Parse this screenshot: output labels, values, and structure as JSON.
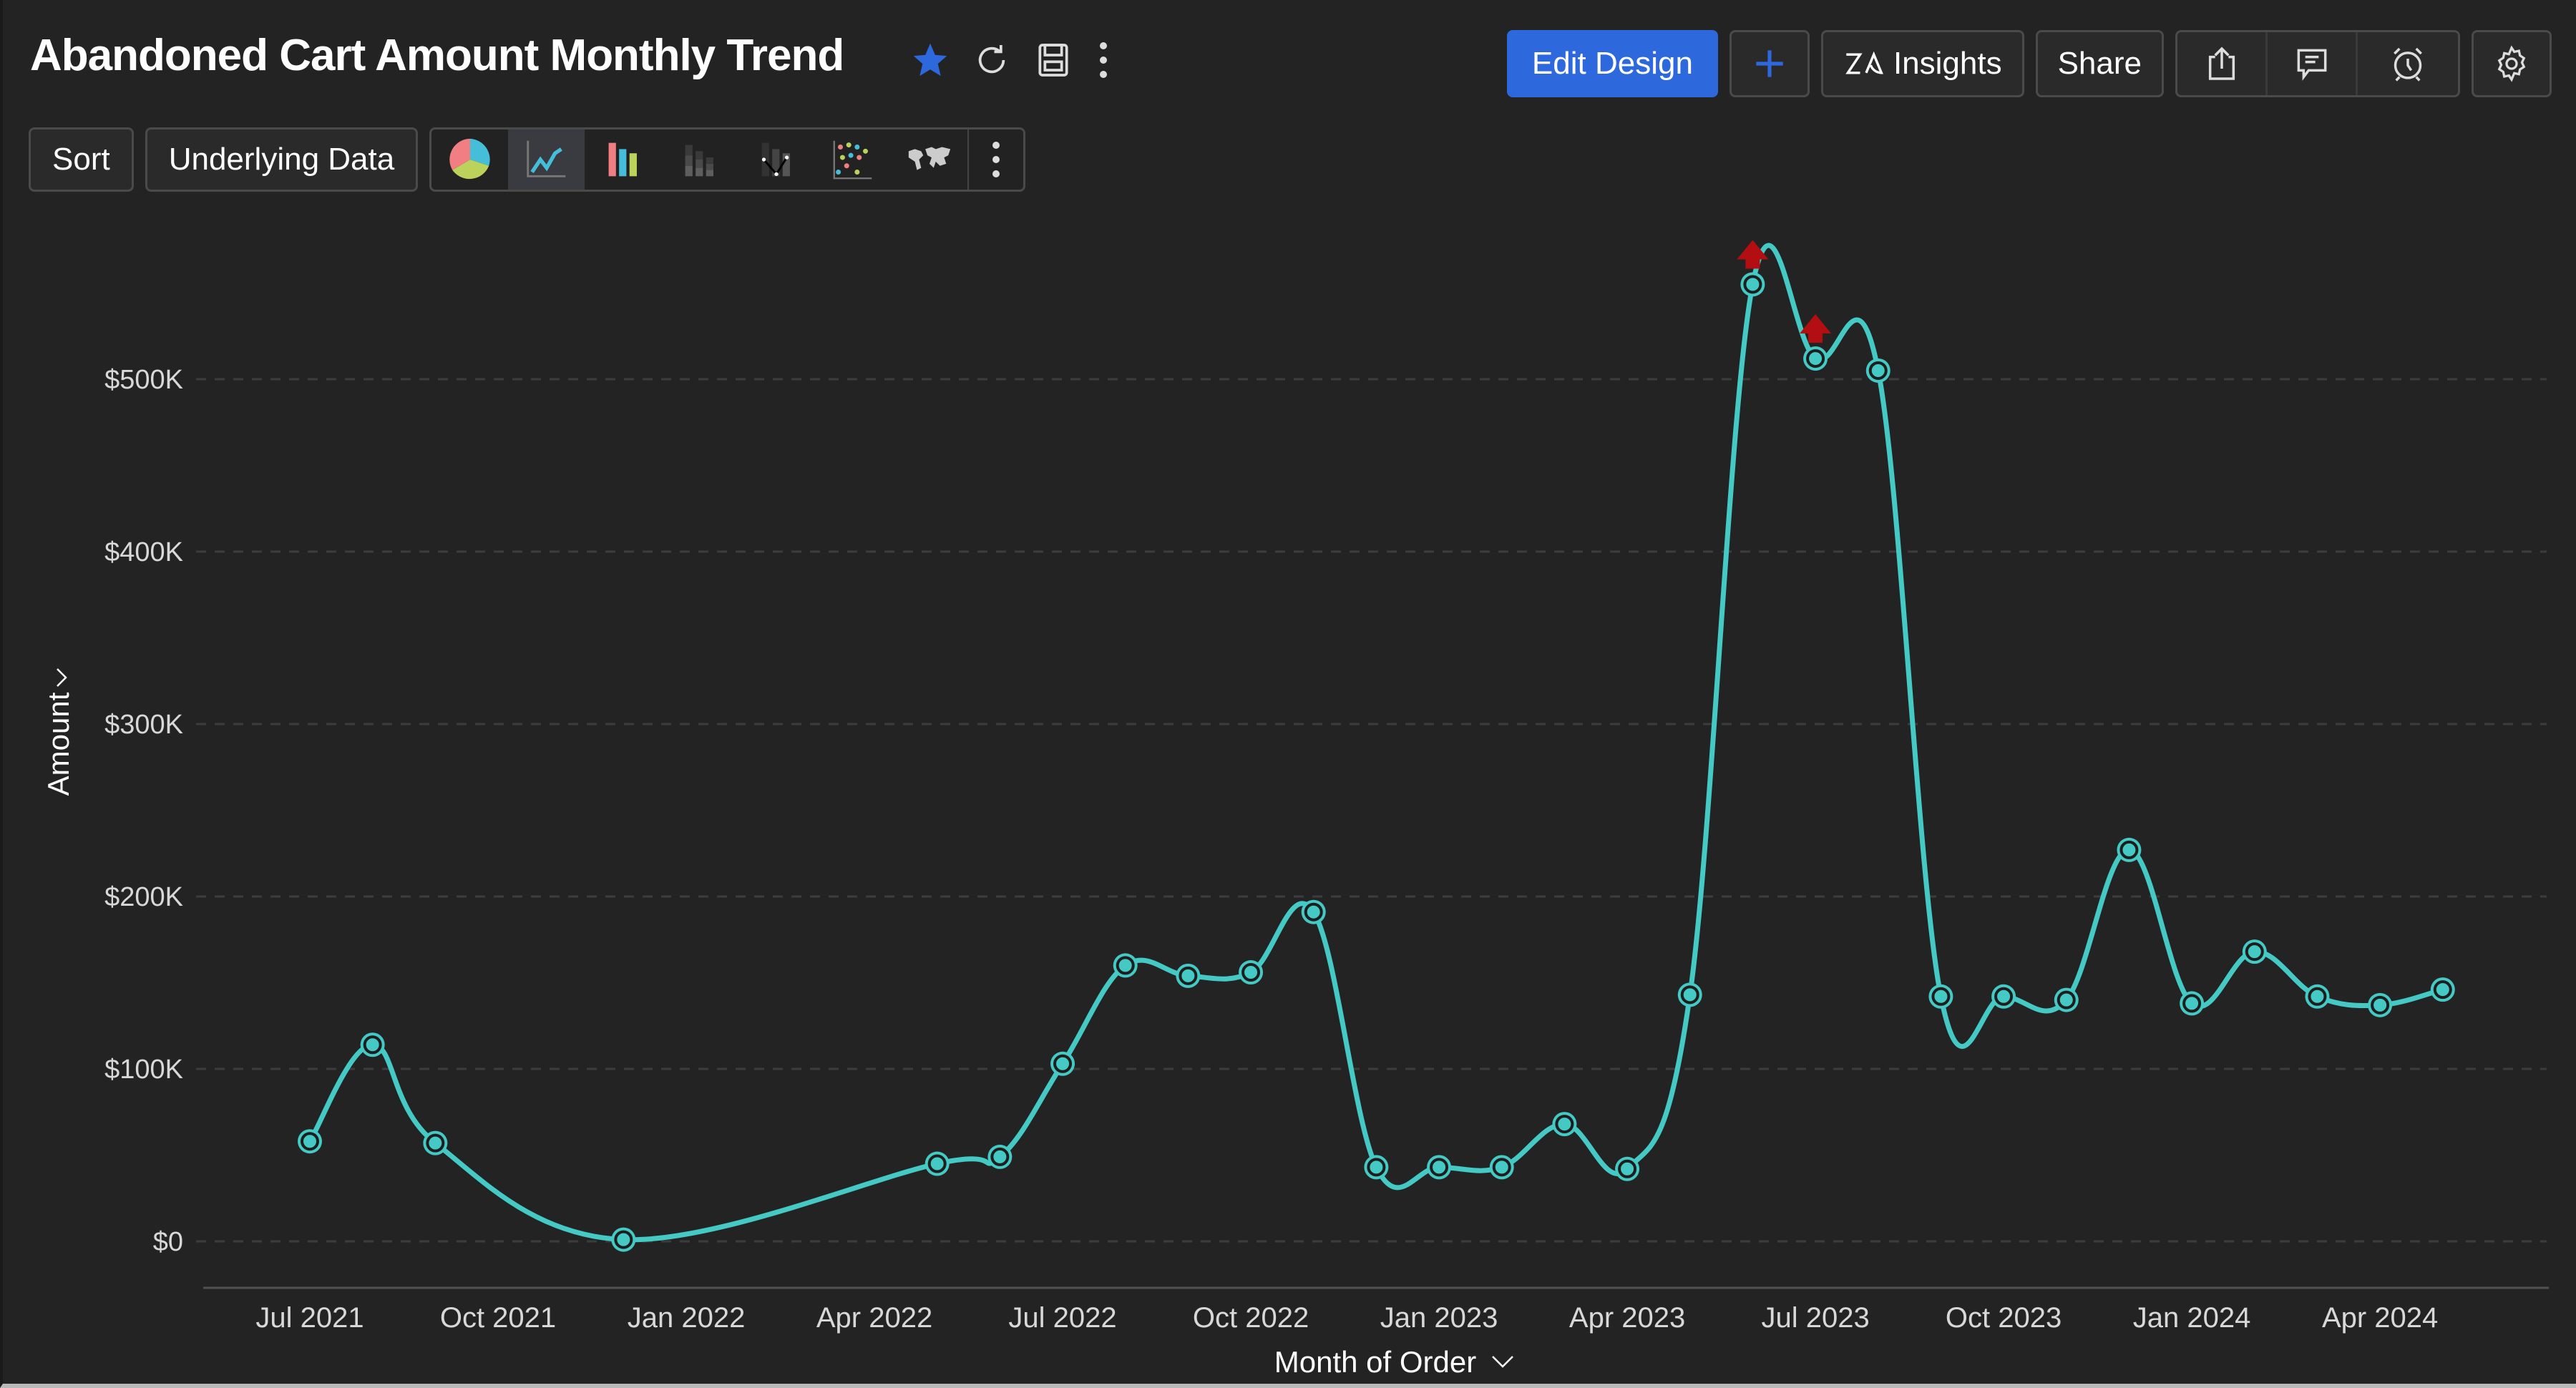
{
  "header": {
    "title": "Abandoned Cart Amount Monthly Trend",
    "icons": [
      "star-icon",
      "refresh-icon",
      "save-icon",
      "more-vertical-icon"
    ]
  },
  "toolbar_right": {
    "edit_design": "Edit Design",
    "add": "+",
    "insights": "Insights",
    "share": "Share",
    "group_icons": [
      "export-icon",
      "comment-icon",
      "alarm-icon"
    ],
    "settings_icon": "gear-icon"
  },
  "toolbar_left": {
    "sort": "Sort",
    "underlying_data": "Underlying Data",
    "chart_types": [
      "pie",
      "line",
      "bar",
      "stacked-bar",
      "combo",
      "scatter",
      "map"
    ],
    "active_chart_type": "line"
  },
  "colors": {
    "background": "#232323",
    "line": "#45c9c4",
    "primary_button": "#2d68dd",
    "anomaly_marker": "#b30f12",
    "star": "#2d68dd"
  },
  "chart_data": {
    "type": "line",
    "title": "Abandoned Cart Amount Monthly Trend",
    "xlabel": "Month of Order",
    "ylabel": "Amount",
    "ylim": [
      0,
      600000
    ],
    "grid": true,
    "yticks": [
      0,
      100000,
      200000,
      300000,
      400000,
      500000
    ],
    "ytick_labels": [
      "$0",
      "$100K",
      "$200K",
      "$300K",
      "$400K",
      "$500K"
    ],
    "xtick_labels": [
      "Jul 2021",
      "Oct 2021",
      "Jan 2022",
      "Apr 2022",
      "Jul 2022",
      "Oct 2022",
      "Jan 2023",
      "Apr 2023",
      "Jul 2023",
      "Oct 2023",
      "Jan 2024",
      "Apr 2024"
    ],
    "x_start": "Jul 2021",
    "series": [
      {
        "name": "Amount",
        "points": [
          {
            "month": "Jul 2021",
            "value": 58000
          },
          {
            "month": "Aug 2021",
            "value": 114000
          },
          {
            "month": "Sep 2021",
            "value": 57000
          },
          {
            "month": "Dec 2021",
            "value": 1000
          },
          {
            "month": "May 2022",
            "value": 45000
          },
          {
            "month": "Jun 2022",
            "value": 49000
          },
          {
            "month": "Jul 2022",
            "value": 103000
          },
          {
            "month": "Aug 2022",
            "value": 160000
          },
          {
            "month": "Sep 2022",
            "value": 154000
          },
          {
            "month": "Oct 2022",
            "value": 156000
          },
          {
            "month": "Nov 2022",
            "value": 191000
          },
          {
            "month": "Dec 2022",
            "value": 43000
          },
          {
            "month": "Jan 2023",
            "value": 43000
          },
          {
            "month": "Feb 2023",
            "value": 43000
          },
          {
            "month": "Mar 2023",
            "value": 68000
          },
          {
            "month": "Apr 2023",
            "value": 42000
          },
          {
            "month": "May 2023",
            "value": 143000
          },
          {
            "month": "Jun 2023",
            "value": 555000,
            "anomaly": "up"
          },
          {
            "month": "Jul 2023",
            "value": 512000,
            "anomaly": "up"
          },
          {
            "month": "Aug 2023",
            "value": 505000
          },
          {
            "month": "Sep 2023",
            "value": 142000
          },
          {
            "month": "Oct 2023",
            "value": 142000
          },
          {
            "month": "Nov 2023",
            "value": 140000
          },
          {
            "month": "Dec 2023",
            "value": 227000
          },
          {
            "month": "Jan 2024",
            "value": 138000
          },
          {
            "month": "Feb 2024",
            "value": 168000
          },
          {
            "month": "Mar 2024",
            "value": 142000
          },
          {
            "month": "Apr 2024",
            "value": 137000
          },
          {
            "month": "May 2024",
            "value": 146000
          }
        ]
      }
    ]
  }
}
